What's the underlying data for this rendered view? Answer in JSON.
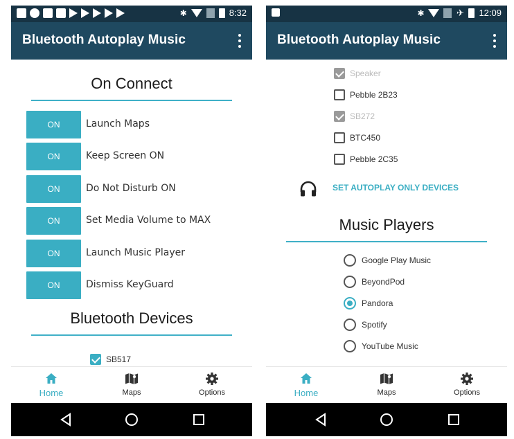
{
  "left": {
    "status": {
      "time": "8:32"
    },
    "app_title": "Bluetooth Autoplay Music",
    "on_connect_title": "On Connect",
    "toggles": [
      {
        "state": "ON",
        "label": "Launch Maps"
      },
      {
        "state": "ON",
        "label": "Keep Screen ON"
      },
      {
        "state": "ON",
        "label": "Do Not Disturb ON"
      },
      {
        "state": "ON",
        "label": "Set Media Volume to MAX"
      },
      {
        "state": "ON",
        "label": "Launch Music Player"
      },
      {
        "state": "ON",
        "label": "Dismiss KeyGuard"
      }
    ],
    "bt_devices_title": "Bluetooth Devices",
    "devices": [
      {
        "label": "SB517",
        "checked": true
      }
    ],
    "nav": {
      "home": "Home",
      "maps": "Maps",
      "options": "Options"
    }
  },
  "right": {
    "status": {
      "time": "12:09"
    },
    "app_title": "Bluetooth Autoplay Music",
    "devices": [
      {
        "label": "Speaker",
        "checked": true,
        "disabled": true
      },
      {
        "label": "Pebble 2B23",
        "checked": false,
        "disabled": false
      },
      {
        "label": "SB272",
        "checked": true,
        "disabled": true
      },
      {
        "label": "BTC450",
        "checked": false,
        "disabled": false
      },
      {
        "label": "Pebble 2C35",
        "checked": false,
        "disabled": false
      }
    ],
    "autoplay_label": "SET AUTOPLAY ONLY DEVICES",
    "music_players_title": "Music Players",
    "players": [
      {
        "label": "Google Play Music",
        "selected": false
      },
      {
        "label": "BeyondPod",
        "selected": false
      },
      {
        "label": "Pandora",
        "selected": true
      },
      {
        "label": "Spotify",
        "selected": false
      },
      {
        "label": "YouTube Music",
        "selected": false
      }
    ],
    "nav": {
      "home": "Home",
      "maps": "Maps",
      "options": "Options"
    }
  },
  "colors": {
    "accent": "#3aaec3",
    "appbar": "#1f4960",
    "statusbar": "#173344"
  },
  "icons": [
    "home-icon",
    "map-icon",
    "gear-icon",
    "headphones-icon",
    "back-icon",
    "home-circle-icon",
    "recents-icon",
    "overflow-menu-icon",
    "bluetooth-icon",
    "wifi-icon",
    "airplane-icon",
    "battery-icon"
  ]
}
